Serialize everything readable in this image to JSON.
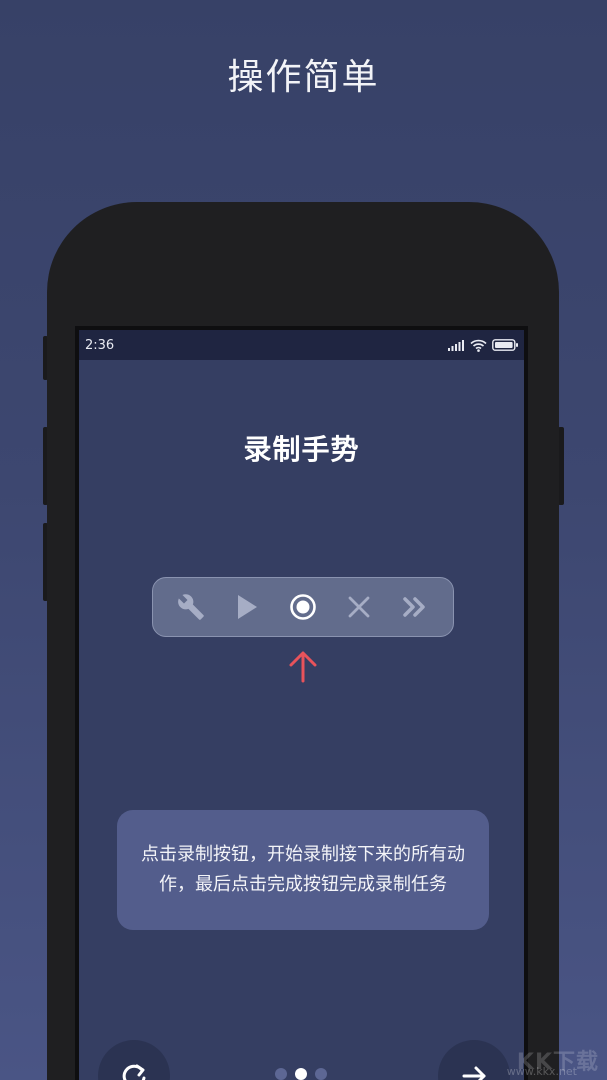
{
  "page": {
    "heading": "操作简单"
  },
  "status_bar": {
    "time": "2:36",
    "icons": [
      "signal-icon",
      "wifi-icon",
      "battery-icon"
    ]
  },
  "app": {
    "title": "录制手势",
    "toolbar": [
      {
        "name": "wrench-icon",
        "label": "settings"
      },
      {
        "name": "play-icon",
        "label": "play"
      },
      {
        "name": "record-icon",
        "label": "record"
      },
      {
        "name": "close-icon",
        "label": "close"
      },
      {
        "name": "double-chevron-right-icon",
        "label": "skip"
      }
    ],
    "highlight_arrow": "arrow-up-icon",
    "tip": "点击录制按钮，开始录制接下来的所有动作，最后点击完成按钮完成录制任务"
  },
  "pager": {
    "dots": 3,
    "active_index": 1
  },
  "watermark": {
    "text": "KK下载",
    "url": "www.kkx.net"
  },
  "colors": {
    "background": "#3d4770",
    "screen": "#353e62",
    "accent_arrow": "#e8535b",
    "tip_box": "#535d8c"
  }
}
